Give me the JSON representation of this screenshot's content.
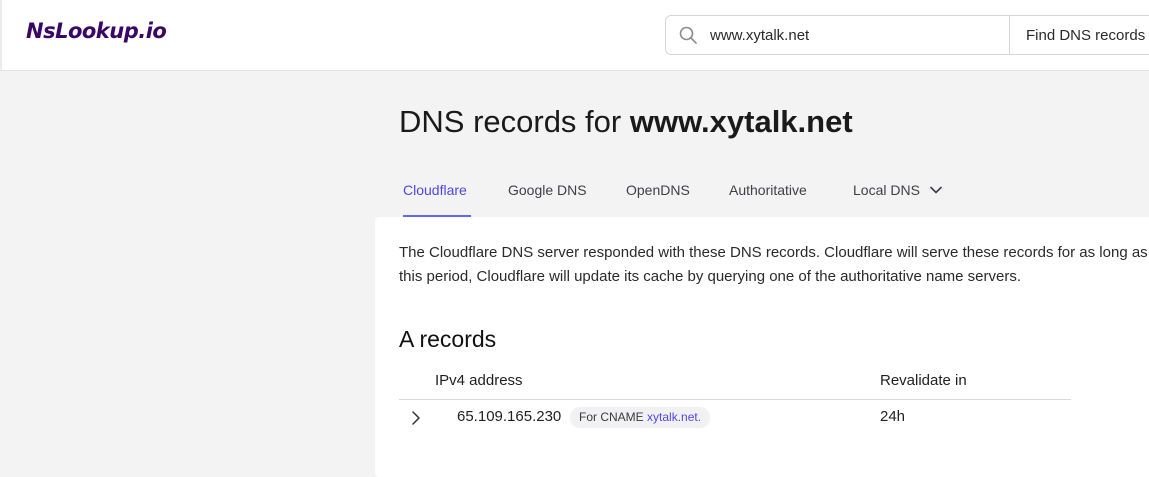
{
  "header": {
    "logo": "NsLookup.io",
    "search": {
      "value": "www.xytalk.net",
      "button_label": "Find DNS records"
    }
  },
  "page": {
    "title_prefix": "DNS records for ",
    "title_domain": "www.xytalk.net"
  },
  "tabs": [
    {
      "label": "Cloudflare",
      "active": true
    },
    {
      "label": "Google DNS"
    },
    {
      "label": "OpenDNS"
    },
    {
      "label": "Authoritative"
    },
    {
      "label": "Local DNS"
    }
  ],
  "description": {
    "line1": "The Cloudflare DNS server responded with these DNS records. Cloudflare will serve these records for as long as the time-to-live (TTL) is. After",
    "line2": "this period, Cloudflare will update its cache by querying one of the authoritative name servers."
  },
  "a_records": {
    "title": "A records",
    "columns": {
      "ip": "IPv4 address",
      "revalidate": "Revalidate in"
    },
    "rows": [
      {
        "ip": "65.109.165.230",
        "cname_prefix": "For CNAME ",
        "cname": "xytalk.net.",
        "revalidate": "24h"
      }
    ]
  },
  "colors": {
    "accent": "#4f46e5",
    "logo": "#3b0764",
    "background": "#f3f3f3"
  },
  "icons": [
    "search-icon",
    "chevron-down-icon",
    "chevron-right-icon"
  ]
}
